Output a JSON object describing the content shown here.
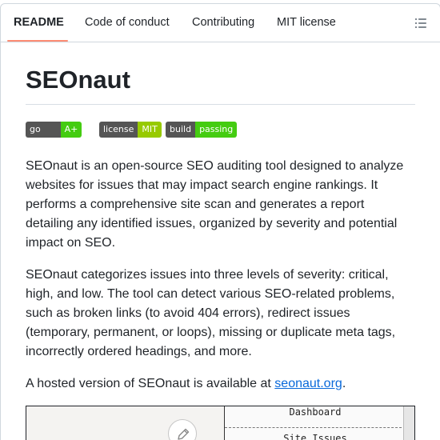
{
  "tabs": [
    {
      "label": "README",
      "active": true
    },
    {
      "label": "Code of conduct",
      "active": false
    },
    {
      "label": "Contributing",
      "active": false
    },
    {
      "label": "MIT license",
      "active": false
    }
  ],
  "toc_icon": "list-unordered-icon",
  "title": "SEOnaut",
  "badges": [
    {
      "label": "go report",
      "value": "A+",
      "color": "#4c1"
    },
    {
      "label": "license",
      "value": "MIT",
      "color": "#97ca00"
    },
    {
      "label": "build",
      "value": "passing",
      "color": "#4c1"
    }
  ],
  "paragraphs": {
    "p1": "SEOnaut is an open-source SEO auditing tool designed to analyze websites for issues that may impact search engine rankings. It performs a comprehensive site scan and generates a report detailing any identified issues, organized by severity and potential impact on SEO.",
    "p2": "SEOnaut categorizes issues into three levels of severity: critical, high, and low. The tool can detect various SEO-related problems, such as broken links (to avoid 404 errors), redirect issues (temporary, permanent, or loops), missing or duplicate meta tags, incorrectly ordered headings, and more.",
    "p3_prefix": "A hosted version of SEOnaut is available at ",
    "p3_link": "seonaut.org",
    "p3_suffix": "."
  },
  "preview": {
    "nav_items": [
      "Dashboard",
      "Site Issues"
    ],
    "edit_icon": "pencil-icon"
  },
  "colors": {
    "accent_underline": "#fd8c73",
    "link": "#0969da"
  }
}
